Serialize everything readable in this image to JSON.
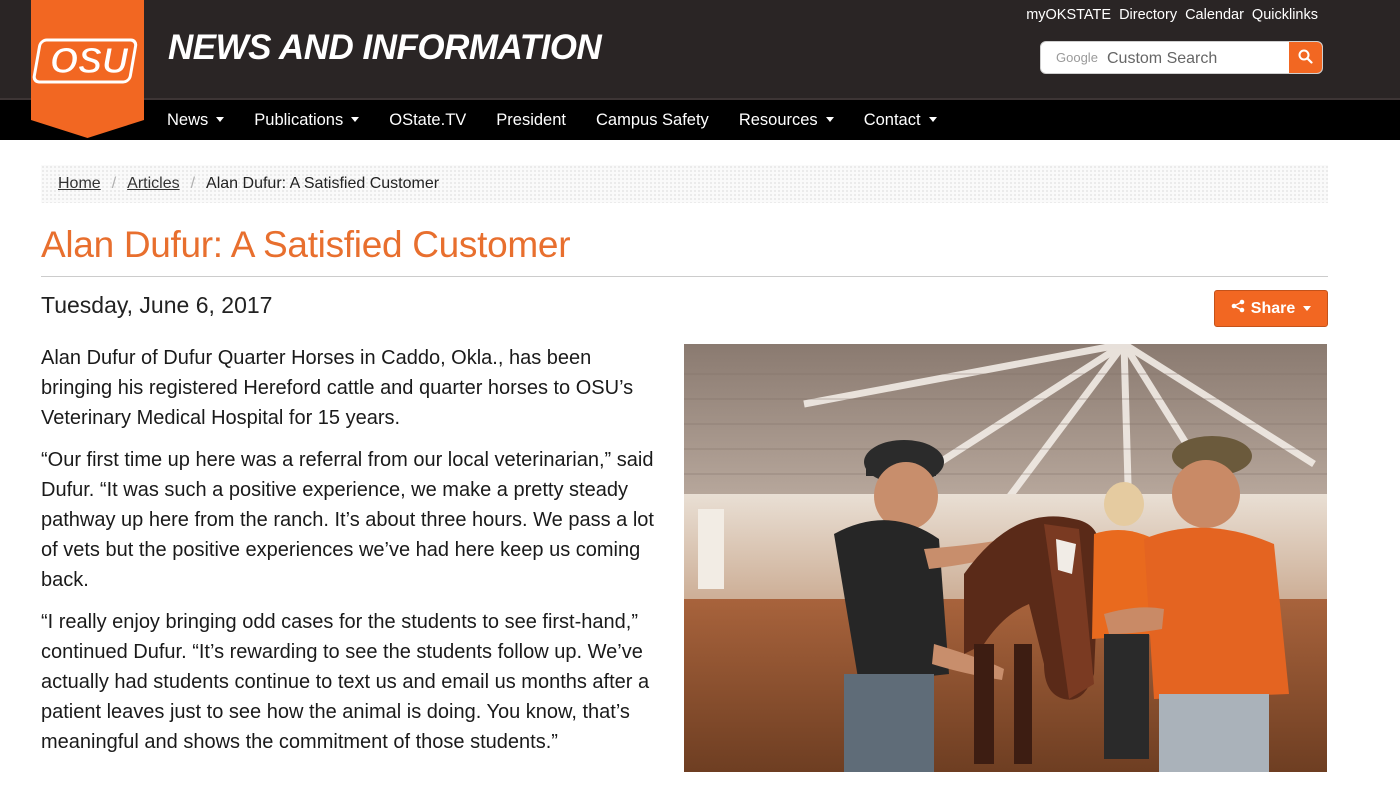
{
  "header": {
    "site_title": "NEWS AND INFORMATION",
    "logo_text": "OSU",
    "util_links": [
      "myOKSTATE",
      "Directory",
      "Calendar",
      "Quicklinks"
    ]
  },
  "search": {
    "brand": "Google",
    "placeholder": "Custom Search",
    "button_icon": "search-icon"
  },
  "nav": {
    "items": [
      {
        "label": "News",
        "dropdown": true
      },
      {
        "label": "Publications",
        "dropdown": true
      },
      {
        "label": "OState.TV",
        "dropdown": false
      },
      {
        "label": "President",
        "dropdown": false
      },
      {
        "label": "Campus Safety",
        "dropdown": false
      },
      {
        "label": "Resources",
        "dropdown": true
      },
      {
        "label": "Contact",
        "dropdown": true
      }
    ]
  },
  "breadcrumb": {
    "items": [
      "Home",
      "Articles"
    ],
    "current": "Alan Dufur: A Satisfied Customer"
  },
  "article": {
    "title": "Alan Dufur: A Satisfied Customer",
    "date": "Tuesday, June 6, 2017",
    "share_label": "Share",
    "paragraphs": [
      "Alan Dufur of Dufur Quarter Horses in Caddo, Okla., has been bringing his registered Hereford cattle and quarter horses to OSU’s Veterinary Medical Hospital for 15 years.",
      "“Our first time up here was a referral from our local veterinarian,” said Dufur. “It was such a positive experience, we make a pretty steady pathway up here from the ranch. It’s about three hours. We pass a lot of vets but the positive experiences we’ve had here keep us coming back.",
      "“I really enjoy bringing odd cases for the students to see first-hand,” continued Dufur. “It’s rewarding to see the students follow up. We’ve actually had students continue to text us and email us months after a patient leaves just to see how the animal is doing. You know, that’s meaningful and shows the commitment of those students.”"
    ]
  },
  "colors": {
    "brand_orange": "#f26722",
    "title_orange": "#e86f2e",
    "header_bg": "#2a2525",
    "nav_bg": "#000000"
  }
}
